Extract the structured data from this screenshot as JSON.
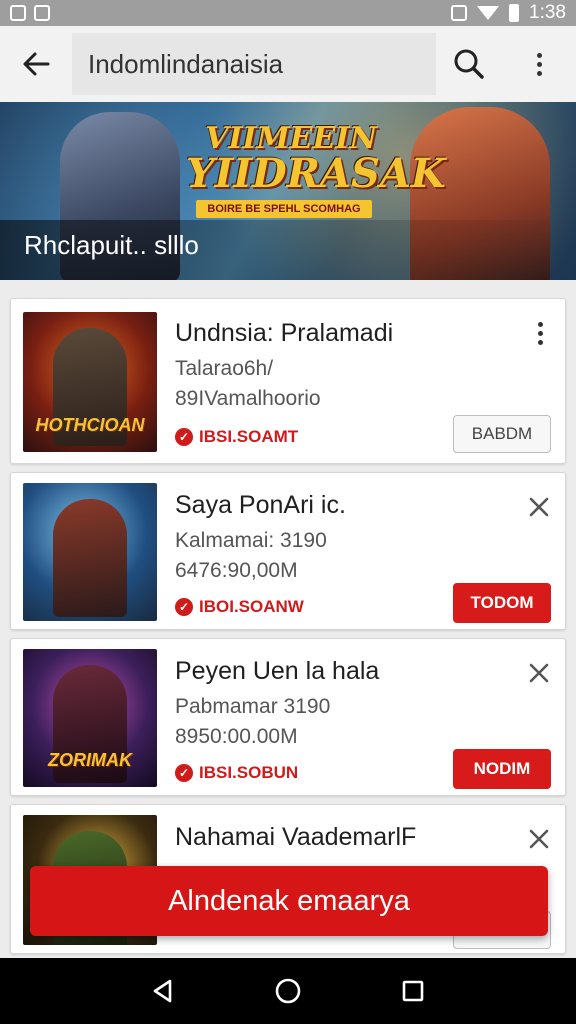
{
  "status_bar": {
    "time": "1:38"
  },
  "app_bar": {
    "search_text": "Indomlindanaisia"
  },
  "banner": {
    "logo_line1": "VIIMEEIN",
    "logo_line2": "YIIDRASAK",
    "logo_tag": "BOIRE BE SPEHL SCOMHAG",
    "caption": "Rhclapuit.. slllo"
  },
  "items": [
    {
      "title": "Undnsia: Pralamadi",
      "line1": "Talarao6h/",
      "line2": "89IVamalhoorio",
      "status": "IBSI.SOAMT",
      "button": "BABDM",
      "button_style": "outline",
      "corner": "menu",
      "thumb_text": "HOTHCIOAN",
      "thumb_colors": [
        "#7a1f12",
        "#d25a16",
        "#2a1010"
      ]
    },
    {
      "title": "Saya PonAri ic.",
      "line1": "Kalmamai: 3190",
      "line2": "6476:90,00M",
      "status": "IBOI.SOANW",
      "button": "TODOM",
      "button_style": "red",
      "corner": "close",
      "thumb_text": "",
      "thumb_colors": [
        "#1f4e80",
        "#58a0d0",
        "#1a2a40"
      ]
    },
    {
      "title": "Peyen Uen la hala",
      "line1": "Pabmamar 3190",
      "line2": "8950:00.00M",
      "status": "IBSI.SOBUN",
      "button": "NODIM",
      "button_style": "red",
      "corner": "close",
      "thumb_text": "ZORIMAK",
      "thumb_colors": [
        "#3b1f5a",
        "#a33a9a",
        "#140a20"
      ]
    },
    {
      "title": "Nahamai VaademarlF",
      "line1": "",
      "line2": "",
      "status": "",
      "button": "",
      "button_style": "outline",
      "corner": "close",
      "thumb_text": "",
      "thumb_colors": [
        "#3a2a10",
        "#c89a30",
        "#1a1408"
      ]
    }
  ],
  "action_button": {
    "label": "Alndenak emaarya"
  },
  "colors": {
    "accent": "#d61616",
    "status_red": "#d01b1b"
  }
}
